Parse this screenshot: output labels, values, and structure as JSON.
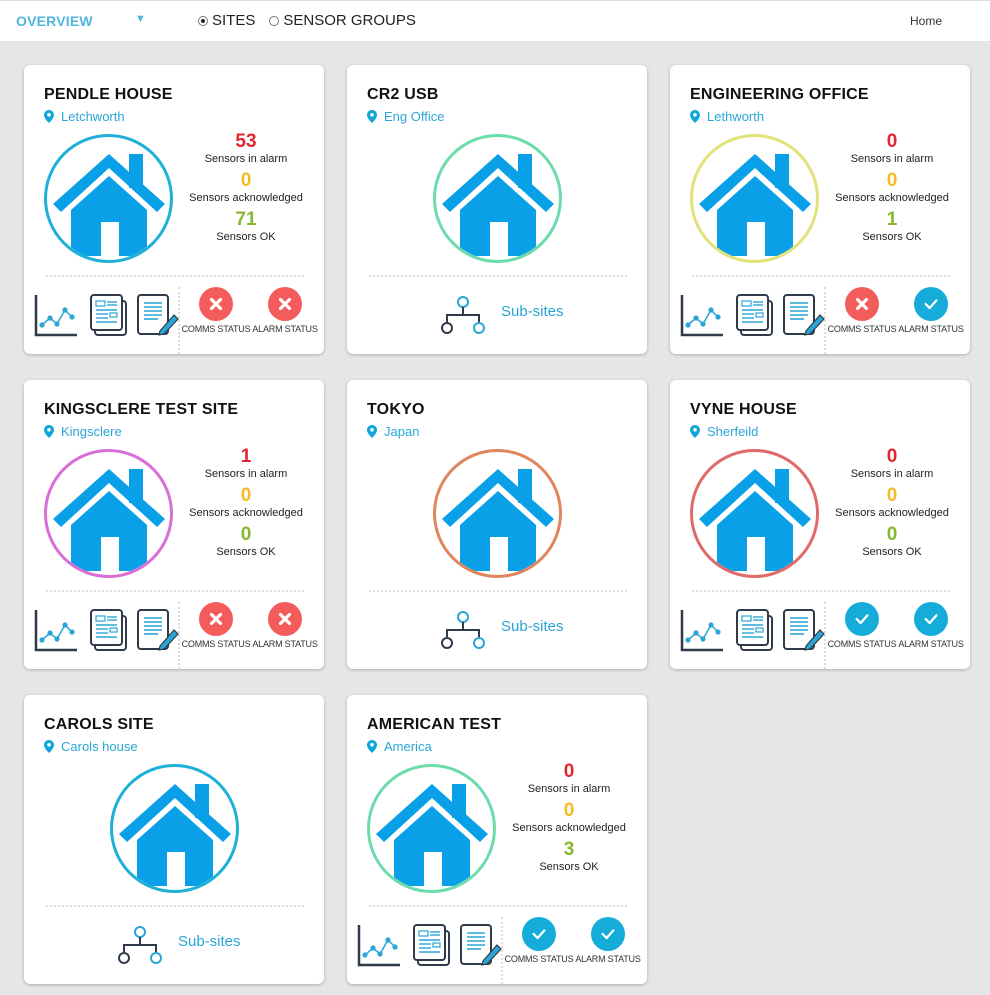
{
  "header": {
    "overview_label": "OVERVIEW",
    "radio_options": [
      {
        "label": "SITES",
        "checked": true
      },
      {
        "label": "SENSOR GROUPS",
        "checked": false
      }
    ],
    "home_label": "Home"
  },
  "labels": {
    "alarm": "Sensors in alarm",
    "acknowledged": "Sensors acknowledged",
    "ok": "Sensors OK",
    "comms_status": "COMMS STATUS",
    "alarm_status": "ALARM STATUS",
    "subsites": "Sub-sites"
  },
  "colors": {
    "accent": "#2aa6d6",
    "alarm": "#e3262d",
    "acknowledged": "#f7b924",
    "ok": "#86b82e",
    "status_bad": "#f45b5b",
    "status_ok": "#16acd9",
    "house": "#0aa0e8"
  },
  "sites": [
    {
      "name": "PENDLE HOUSE",
      "location": "Letchworth",
      "ring_color": "#1fb0d8",
      "type": "sensors",
      "alarm": "53",
      "acknowledged": "0",
      "ok": "71",
      "comms_status": "bad",
      "alarm_status": "bad"
    },
    {
      "name": "CR2 USB",
      "location": "Eng Office",
      "ring_color": "#6ddcab",
      "type": "subsites"
    },
    {
      "name": "ENGINEERING OFFICE",
      "location": "Lethworth",
      "ring_color": "#e2e27a",
      "type": "sensors",
      "alarm": "0",
      "acknowledged": "0",
      "ok": "1",
      "comms_status": "bad",
      "alarm_status": "ok"
    },
    {
      "name": "KINGSCLERE TEST SITE",
      "location": "Kingsclere",
      "ring_color": "#d86fd6",
      "type": "sensors",
      "alarm": "1",
      "acknowledged": "0",
      "ok": "0",
      "comms_status": "bad",
      "alarm_status": "bad"
    },
    {
      "name": "TOKYO",
      "location": "Japan",
      "ring_color": "#e0865e",
      "type": "subsites"
    },
    {
      "name": "VYNE HOUSE",
      "location": "Sherfeild",
      "ring_color": "#e06a6a",
      "type": "sensors",
      "alarm": "0",
      "acknowledged": "0",
      "ok": "0",
      "comms_status": "ok",
      "alarm_status": "ok"
    },
    {
      "name": "CAROLS SITE",
      "location": "Carols house",
      "ring_color": "#1fb0d8",
      "type": "subsites"
    },
    {
      "name": "AMERICAN TEST",
      "location": "America",
      "ring_color": "#6ddcab",
      "type": "sensors",
      "alarm": "0",
      "acknowledged": "0",
      "ok": "3",
      "comms_status": "ok",
      "alarm_status": "ok"
    }
  ]
}
